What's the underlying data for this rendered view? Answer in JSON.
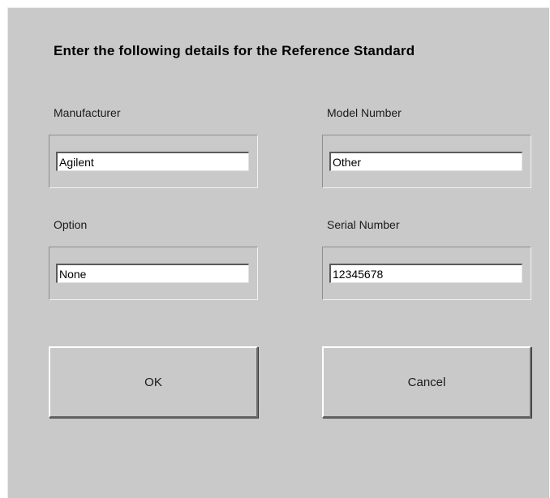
{
  "dialog": {
    "title": "Enter the following details for the Reference Standard"
  },
  "fields": {
    "manufacturer": {
      "label": "Manufacturer",
      "value": "Agilent"
    },
    "model_number": {
      "label": "Model Number",
      "value": "Other"
    },
    "option": {
      "label": "Option",
      "value": "None"
    },
    "serial_number": {
      "label": "Serial Number",
      "value": "12345678"
    }
  },
  "buttons": {
    "ok_label": "OK",
    "cancel_label": "Cancel"
  },
  "colors": {
    "dialog_background": "#c9c9c9",
    "input_background": "#ffffff"
  }
}
